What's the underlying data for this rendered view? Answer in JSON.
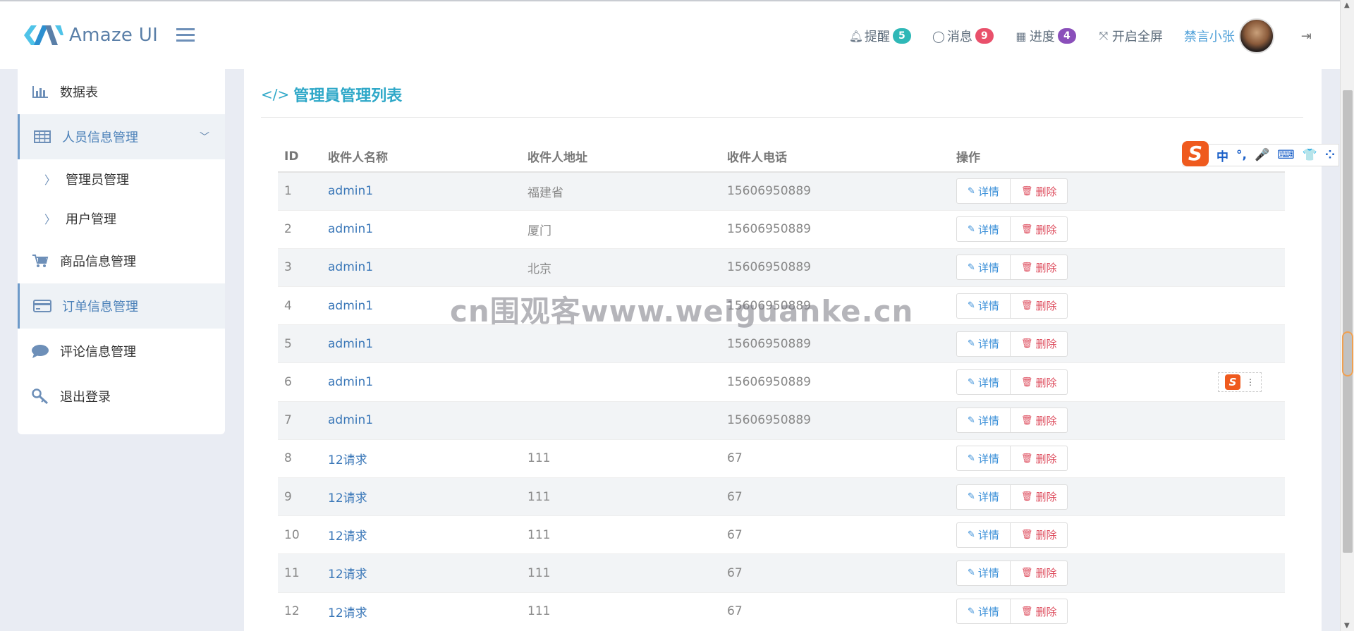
{
  "header": {
    "logo_text": "Amaze UI",
    "nav": [
      {
        "icon": "bell-icon",
        "label": "提醒",
        "badge": "5",
        "badge_color": "#2fb8b7"
      },
      {
        "icon": "comment-icon",
        "label": "消息",
        "badge": "9",
        "badge_color": "#e9506b"
      },
      {
        "icon": "calendar-icon",
        "label": "进度",
        "badge": "4",
        "badge_color": "#8a4fba"
      },
      {
        "icon": "fullscreen-icon",
        "label": "开启全屏"
      }
    ],
    "user_name": "禁言小张"
  },
  "sidebar": {
    "items": [
      {
        "label": "数据表",
        "icon": "bar-chart-icon"
      },
      {
        "label": "人员信息管理",
        "icon": "table-icon",
        "expanded": true
      },
      {
        "label": "管理员管理"
      },
      {
        "label": "用户管理"
      },
      {
        "label": "商品信息管理",
        "icon": "cart-icon"
      },
      {
        "label": "订单信息管理",
        "icon": "credit-card-icon"
      },
      {
        "label": "评论信息管理",
        "icon": "comment-icon"
      },
      {
        "label": "退出登录",
        "icon": "key-icon"
      }
    ]
  },
  "main": {
    "title": "管理員管理列表",
    "columns": [
      "ID",
      "收件人名称",
      "收件人地址",
      "收件人电话",
      "操作"
    ],
    "detail_label": "详情",
    "delete_label": "删除",
    "rows": [
      {
        "id": "1",
        "name": "admin1",
        "address": "福建省",
        "phone": "15606950889"
      },
      {
        "id": "2",
        "name": "admin1",
        "address": "厦门",
        "phone": "15606950889"
      },
      {
        "id": "3",
        "name": "admin1",
        "address": "北京",
        "phone": "15606950889"
      },
      {
        "id": "4",
        "name": "admin1",
        "address": "",
        "phone": "15606950889"
      },
      {
        "id": "5",
        "name": "admin1",
        "address": "",
        "phone": "15606950889"
      },
      {
        "id": "6",
        "name": "admin1",
        "address": "",
        "phone": "15606950889"
      },
      {
        "id": "7",
        "name": "admin1",
        "address": "",
        "phone": "15606950889"
      },
      {
        "id": "8",
        "name": "12请求",
        "address": "111",
        "phone": "67"
      },
      {
        "id": "9",
        "name": "12请求",
        "address": "111",
        "phone": "67"
      },
      {
        "id": "10",
        "name": "12请求",
        "address": "111",
        "phone": "67"
      },
      {
        "id": "11",
        "name": "12请求",
        "address": "111",
        "phone": "67"
      },
      {
        "id": "12",
        "name": "12请求",
        "address": "111",
        "phone": "67"
      }
    ]
  },
  "watermark": "cn围观客www.weiguanke.cn",
  "ime": {
    "keys": [
      "中",
      "°,",
      "🎤",
      "⌨",
      "👕",
      "⁘"
    ]
  }
}
